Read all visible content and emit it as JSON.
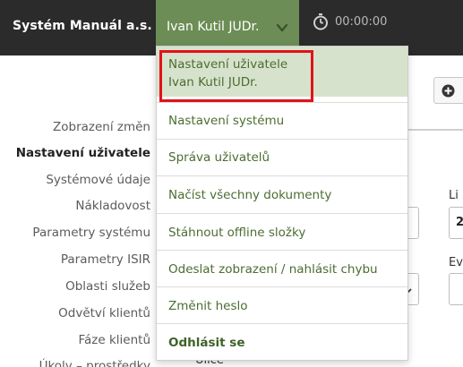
{
  "topbar": {
    "brand": "Systém Manuál a.s.",
    "user_name": "Ivan Kutil JUDr.",
    "timer": "00:00:00"
  },
  "nav": {
    "items": [
      {
        "label": "Zobrazení změn"
      },
      {
        "label": "Nastavení uživatele"
      },
      {
        "label": "Systémové údaje"
      },
      {
        "label": "Nákladovost"
      },
      {
        "label": "Parametry systému"
      },
      {
        "label": "Parametry ISIR"
      },
      {
        "label": "Oblasti služeb"
      },
      {
        "label": "Odvětví klientů"
      },
      {
        "label": "Fáze klientů"
      },
      {
        "label": "Úkoly – prostředky"
      }
    ],
    "active_index": 1
  },
  "background": {
    "label_li": "Li",
    "field_value_2": "2",
    "label_ev": "Ev",
    "label_ulice": "Ulice"
  },
  "dropdown": {
    "header_line1": "Nastavení uživatele",
    "header_line2": "Ivan Kutil JUDr.",
    "items": [
      {
        "label": "Nastavení systému"
      },
      {
        "label": "Správa uživatelů"
      },
      {
        "label": "Načíst všechny dokumenty"
      },
      {
        "label": "Stáhnout offline složky"
      },
      {
        "label": "Odeslat zobrazení / nahlásit chybu"
      },
      {
        "label": "Změnit heslo"
      },
      {
        "label": "Odhlásit se"
      }
    ]
  },
  "colors": {
    "topbar_bg": "#2b2b2b",
    "accent_green": "#6c8d55",
    "link_green": "#4b6d31",
    "highlight_red": "#e1121a"
  }
}
